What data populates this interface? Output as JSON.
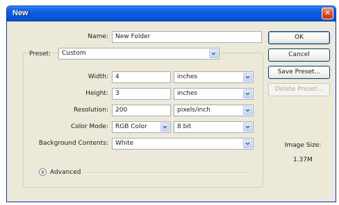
{
  "window": {
    "title": "New",
    "close_glyph": "✕"
  },
  "form": {
    "name_label": "Name:",
    "name_value": "New Folder",
    "preset_label": "Preset:",
    "preset_value": "Custom",
    "width_label": "Width:",
    "width_value": "4",
    "width_unit": "inches",
    "height_label": "Height:",
    "height_value": "3",
    "height_unit": "inches",
    "resolution_label": "Resolution:",
    "resolution_value": "200",
    "resolution_unit": "pixels/inch",
    "color_mode_label": "Color Mode:",
    "color_mode_value": "RGB Color",
    "bit_depth_value": "8 bit",
    "background_label": "Background Contents:",
    "background_value": "White",
    "advanced_label": "Advanced"
  },
  "buttons": {
    "ok": "OK",
    "cancel": "Cancel",
    "save_preset": "Save Preset...",
    "delete_preset": "Delete Preset..."
  },
  "info": {
    "image_size_label": "Image Size:",
    "image_size_value": "1.37M"
  },
  "colors": {
    "titlebar": "#0854d8",
    "dialog_bg": "#ece9d8",
    "close_button": "#e2461c"
  },
  "icons": {
    "close": "close-icon",
    "dropdown": "chevron-down-icon",
    "advanced": "expand-chevron-icon"
  }
}
